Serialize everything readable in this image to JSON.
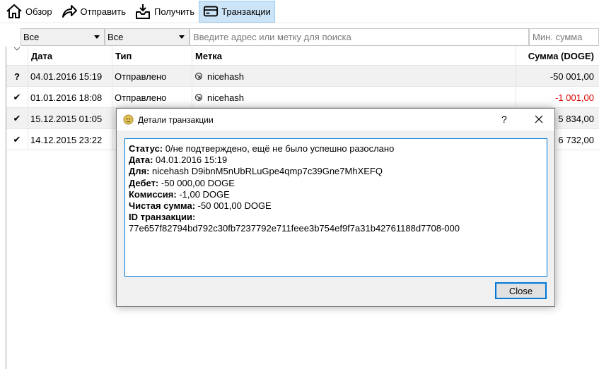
{
  "toolbar": {
    "overview": "Обзор",
    "send": "Отправить",
    "receive": "Получить",
    "transactions": "Транзакции"
  },
  "filters": {
    "date_filter": "Все",
    "type_filter": "Все",
    "search_placeholder": "Введите адрес или метку для поиска",
    "min_amount_placeholder": "Мин. сумма"
  },
  "table": {
    "headers": {
      "date": "Дата",
      "type": "Тип",
      "label": "Метка",
      "amount": "Сумма (DOGE)"
    },
    "rows": [
      {
        "status": "?",
        "date": "04.01.2016 15:19",
        "type": "Отправлено",
        "label": "nicehash",
        "amount": "-50 001,00"
      },
      {
        "status": "✔",
        "date": "01.01.2016 18:08",
        "type": "Отправлено",
        "label": "nicehash",
        "amount": "-1 001,00"
      },
      {
        "status": "✔",
        "date": "15.12.2015 01:05",
        "type": "",
        "label": "",
        "amount": "5 834,00"
      },
      {
        "status": "✔",
        "date": "14.12.2015 23:22",
        "type": "",
        "label": "",
        "amount": "6 732,00"
      }
    ]
  },
  "dialog": {
    "title": "Детали транзакции",
    "help": "?",
    "close_button": "Close",
    "details": {
      "status_label": "Статус:",
      "status_value": " 0/не подтверждено, ещё не было успешно разослано",
      "date_label": "Дата:",
      "date_value": " 04.01.2016 15:19",
      "for_label": "Для:",
      "for_value": " nicehash D9ibnM5nUbRLuGpe4qmp7c39Gne7MhXEFQ",
      "debit_label": "Дебет:",
      "debit_value": " -50 000,00 DOGE",
      "fee_label": "Комиссия:",
      "fee_value": " -1,00 DOGE",
      "net_label": "Чистая сумма:",
      "net_value": " -50 001,00 DOGE",
      "txid_label": "ID транзакции:",
      "txid_value": "77e657f82794bd792c30fb7237792e711feee3b754ef9f7a31b42761188d7708-000"
    }
  },
  "colors": {
    "negative": "#e00000",
    "accent": "#0078d7",
    "active_tab": "#cce4f7"
  }
}
